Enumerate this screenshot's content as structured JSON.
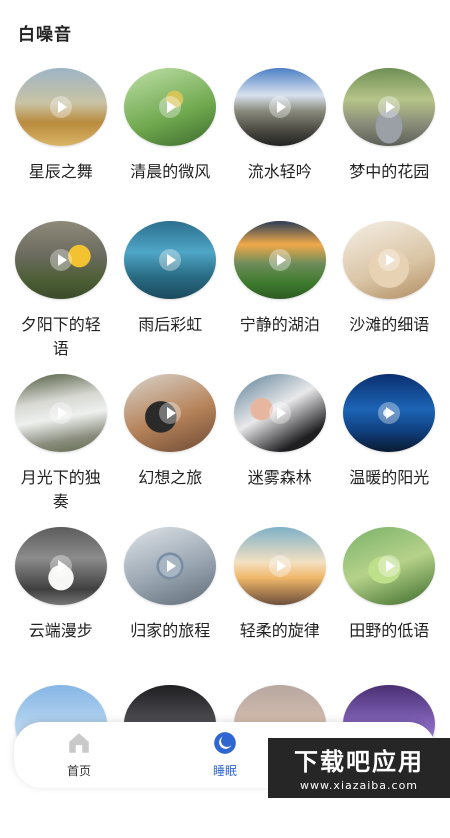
{
  "header": {
    "title": "白噪音"
  },
  "items": [
    {
      "title": "星辰之舞"
    },
    {
      "title": "清晨的微风"
    },
    {
      "title": "流水轻吟"
    },
    {
      "title": "梦中的花园"
    },
    {
      "title": "夕阳下的轻语"
    },
    {
      "title": "雨后彩虹"
    },
    {
      "title": "宁静的湖泊"
    },
    {
      "title": "沙滩的细语"
    },
    {
      "title": "月光下的独奏"
    },
    {
      "title": "幻想之旅"
    },
    {
      "title": "迷雾森林"
    },
    {
      "title": "温暖的阳光"
    },
    {
      "title": "云端漫步"
    },
    {
      "title": "归家的旅程"
    },
    {
      "title": "轻柔的旋律"
    },
    {
      "title": "田野的低语"
    }
  ],
  "nav": {
    "items": [
      {
        "label": "首页",
        "icon": "home-icon"
      },
      {
        "label": "睡眠",
        "icon": "moon-icon"
      }
    ],
    "active": "睡眠",
    "active_color": "#2f66d0"
  },
  "watermark": {
    "title": "下载吧应用",
    "url": "www.xiazaiba.com"
  }
}
